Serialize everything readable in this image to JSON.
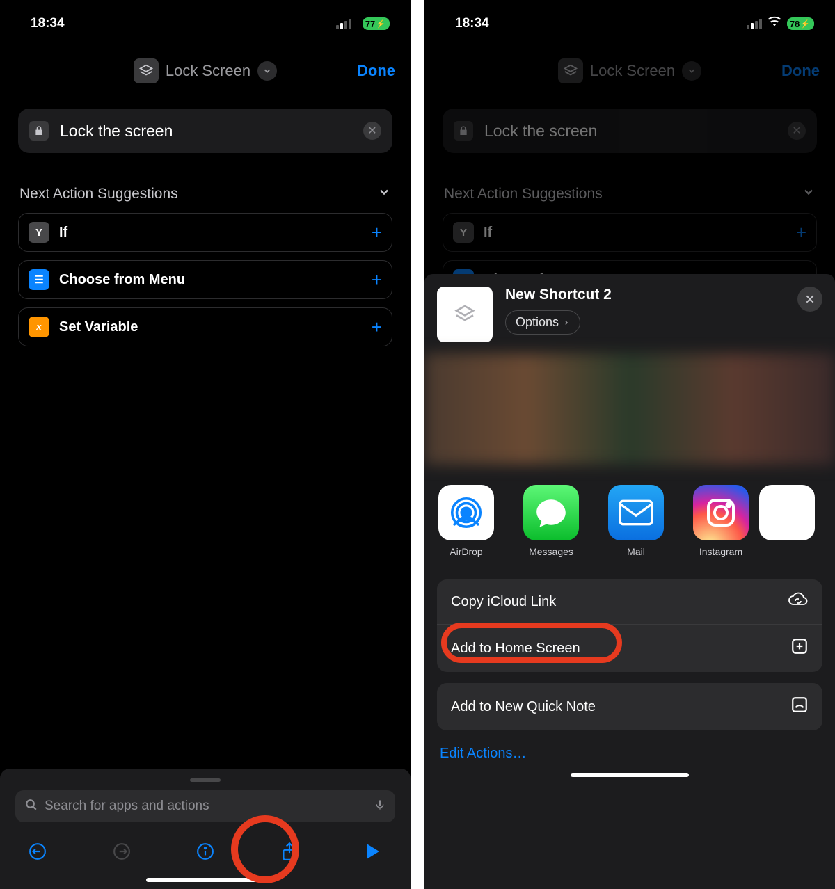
{
  "left": {
    "status": {
      "time": "18:34",
      "battery": "77"
    },
    "nav": {
      "title": "Lock Screen",
      "done": "Done"
    },
    "action_pill": {
      "label": "Lock the screen"
    },
    "suggestions_header": "Next Action Suggestions",
    "suggestions": [
      {
        "label": "If"
      },
      {
        "label": "Choose from Menu"
      },
      {
        "label": "Set Variable"
      }
    ],
    "search_placeholder": "Search for apps and actions"
  },
  "right": {
    "status": {
      "time": "18:34",
      "battery": "78"
    },
    "nav": {
      "title": "Lock Screen",
      "done": "Done"
    },
    "action_pill": {
      "label": "Lock the screen"
    },
    "suggestions_header": "Next Action Suggestions",
    "suggestions": [
      {
        "label": "If"
      },
      {
        "label": "Choose from Menu"
      }
    ],
    "share": {
      "title": "New Shortcut 2",
      "options": "Options",
      "apps": [
        {
          "label": "AirDrop"
        },
        {
          "label": "Messages"
        },
        {
          "label": "Mail"
        },
        {
          "label": "Instagram"
        }
      ],
      "actions": [
        {
          "label": "Copy iCloud Link"
        },
        {
          "label": "Add to Home Screen"
        }
      ],
      "note_action": "Add to New Quick Note",
      "edit": "Edit Actions…"
    }
  }
}
